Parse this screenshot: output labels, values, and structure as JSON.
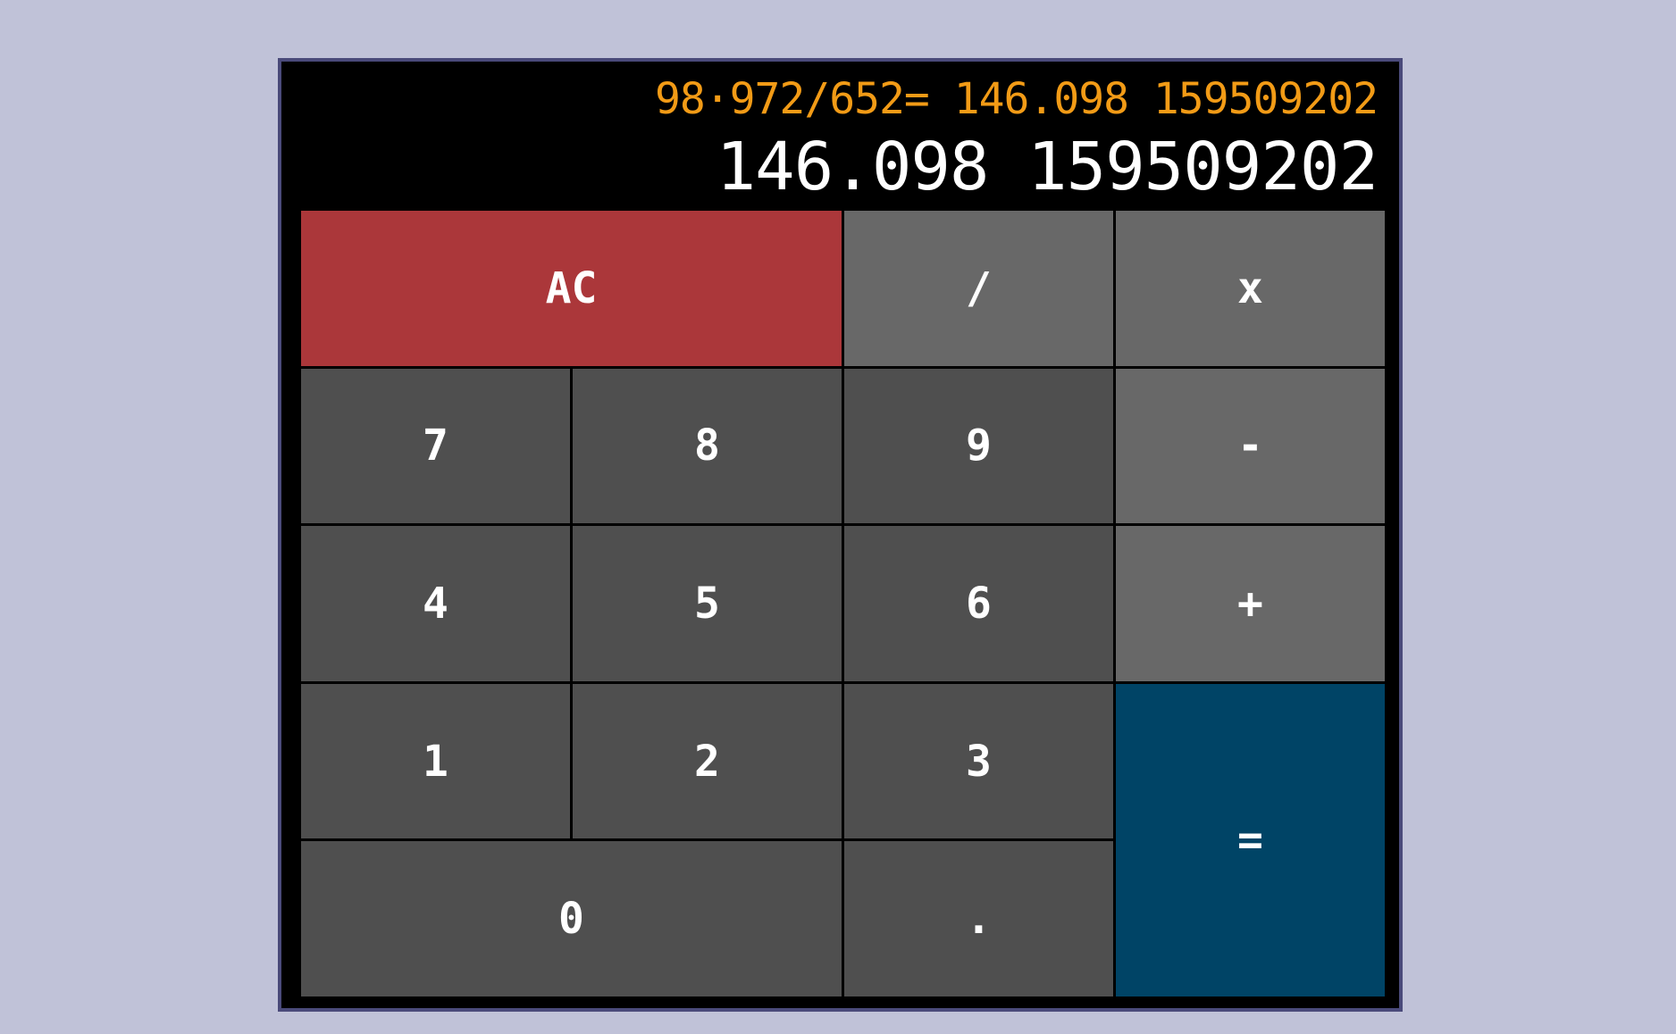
{
  "display": {
    "expression": "98·972/652= 146.098 159509202",
    "result": "146.098 159509202"
  },
  "colors": {
    "background": "#c0c2d8",
    "display_bg": "#000000",
    "expression_text": "#f29b16",
    "result_text": "#ffffff",
    "key_number": "#4f4f4f",
    "key_operator": "#686868",
    "key_clear": "#ab373a",
    "key_equals": "#004466"
  },
  "keys": {
    "clear": "AC",
    "divide": "/",
    "multiply": "x",
    "seven": "7",
    "eight": "8",
    "nine": "9",
    "minus": "-",
    "four": "4",
    "five": "5",
    "six": "6",
    "plus": "+",
    "one": "1",
    "two": "2",
    "three": "3",
    "equals": "=",
    "zero": "0",
    "decimal": "."
  }
}
